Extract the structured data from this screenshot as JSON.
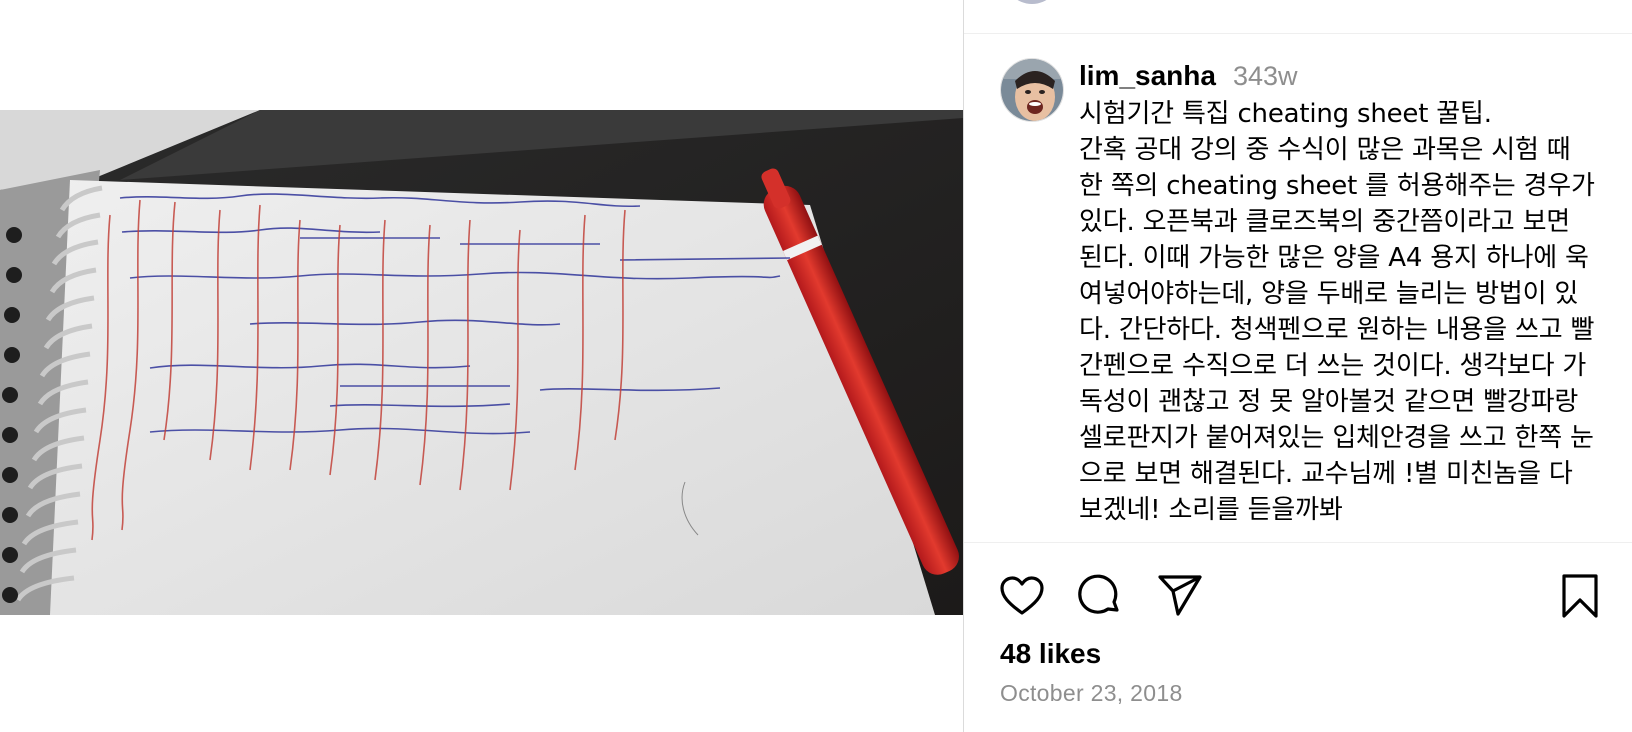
{
  "post": {
    "username": "lim_sanha",
    "age": "343w",
    "caption": "시험기간 특집 cheating sheet 꿀팁.\n간혹 공대 강의 중 수식이 많은 과목은 시험 때 한 쪽의 cheating sheet 를 허용해주는 경우가 있다. 오픈북과 클로즈북의 중간쯤이라고 보면 된다. 이때 가능한 많은 양을 A4 용지 하나에 욱여넣어야하는데, 양을 두배로 늘리는 방법이 있다. 간단하다. 청색펜으로 원하는 내용을 쓰고 빨간펜으로 수직으로 더 쓰는 것이다. 생각보다 가독성이 괜찮고 정 못 알아볼것 같으면 빨강파랑 셀로판지가 붙어져있는 입체안경을 쓰고 한쪽 눈으로 보면 해결된다. 교수님께 !별 미친놈을 다 보겠네! 소리를 듣을까봐",
    "likes": "48 likes",
    "date": "October 23, 2018"
  },
  "icons": {
    "like": "heart-outline-icon",
    "comment": "speech-bubble-icon",
    "share": "paper-plane-icon",
    "save": "bookmark-outline-icon"
  },
  "colors": {
    "secondary_text": "#8e8e8e",
    "border": "#dbdbdb",
    "blue_ink": "#3a3f9e",
    "red_ink": "#c2423a"
  }
}
